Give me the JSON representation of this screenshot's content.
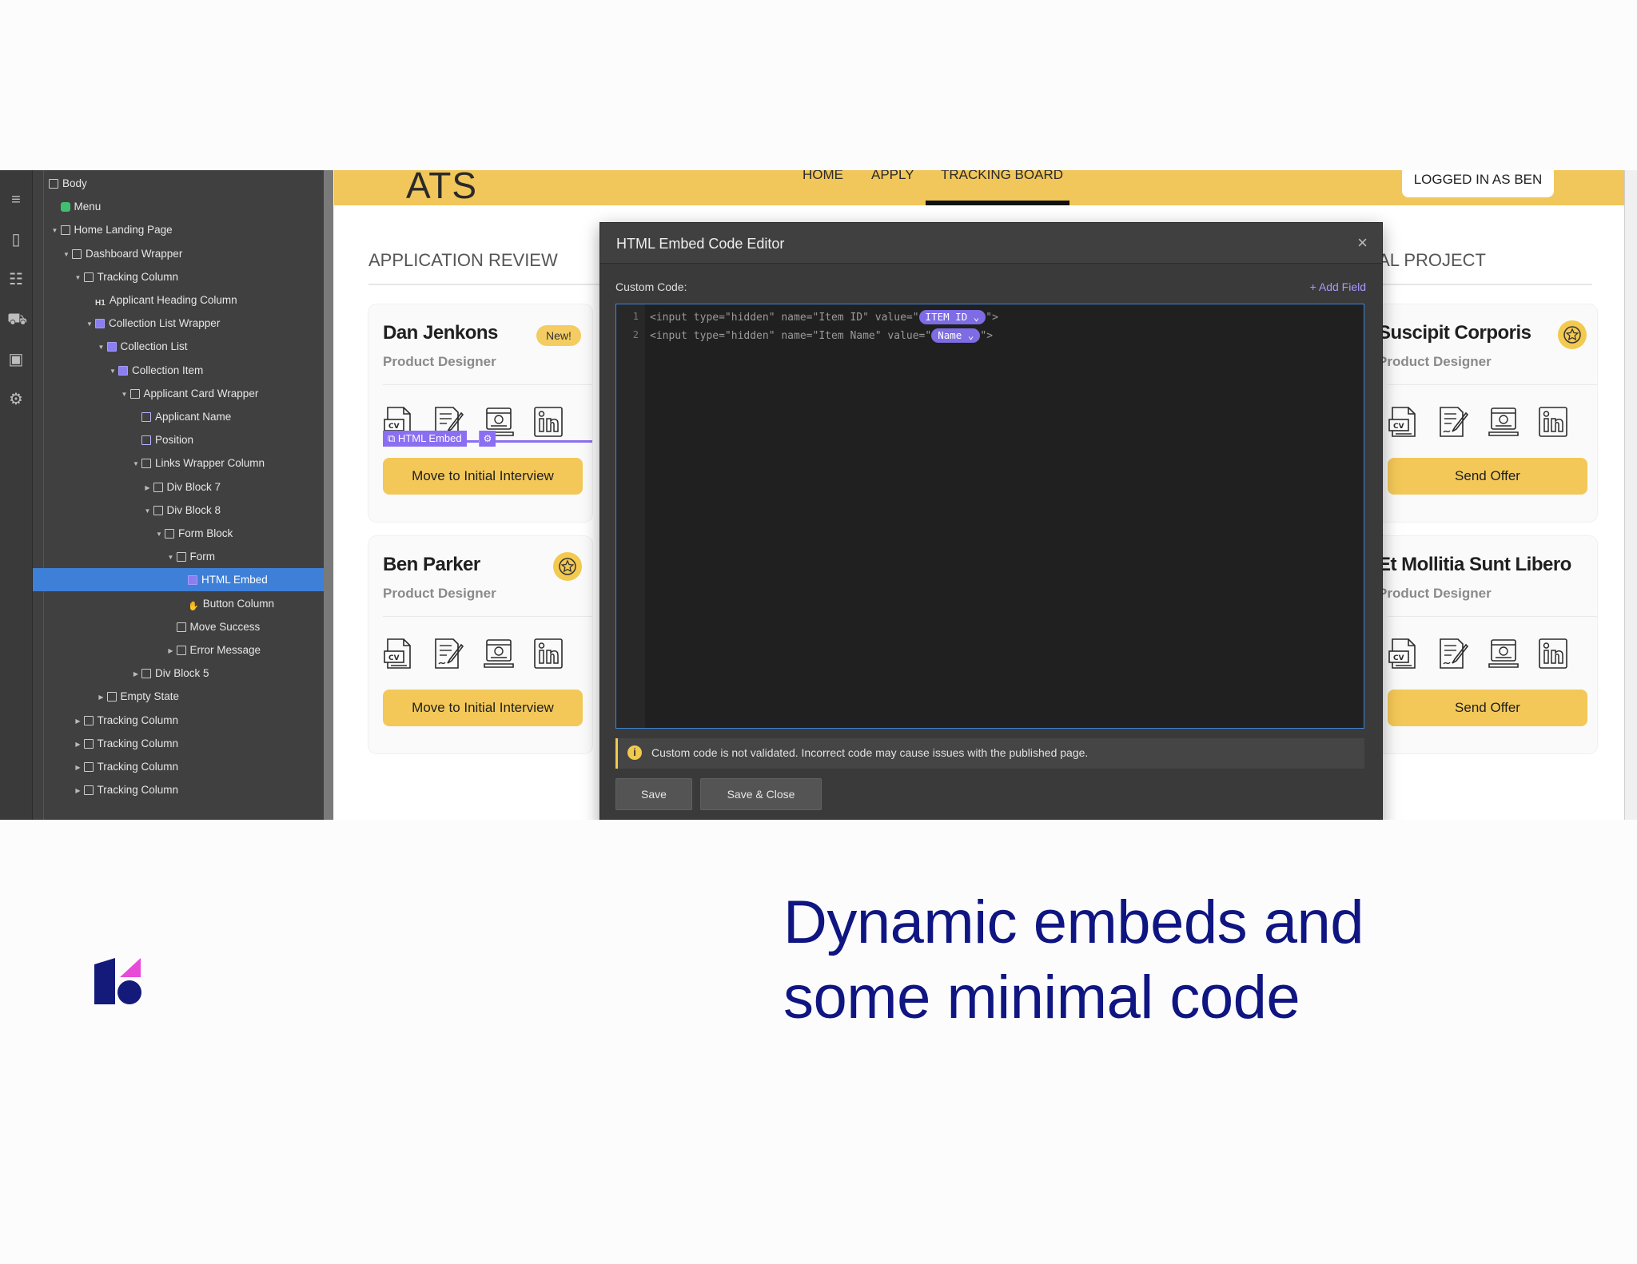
{
  "navigator": {
    "items": [
      {
        "label": "Body",
        "depth": 0,
        "icon": "box"
      },
      {
        "label": "Menu",
        "depth": 1,
        "icon": "component"
      },
      {
        "label": "Home Landing Page",
        "depth": 1,
        "icon": "box"
      },
      {
        "label": "Dashboard Wrapper",
        "depth": 2,
        "icon": "box"
      },
      {
        "label": "Tracking Column",
        "depth": 3,
        "icon": "box"
      },
      {
        "label": "Applicant Heading Column",
        "depth": 4,
        "icon": "h1"
      },
      {
        "label": "Collection List Wrapper",
        "depth": 4,
        "icon": "collection"
      },
      {
        "label": "Collection List",
        "depth": 5,
        "icon": "collection"
      },
      {
        "label": "Collection Item",
        "depth": 6,
        "icon": "collection"
      },
      {
        "label": "Applicant Card Wrapper",
        "depth": 7,
        "icon": "box"
      },
      {
        "label": "Applicant Name",
        "depth": 8,
        "icon": "text"
      },
      {
        "label": "Position",
        "depth": 8,
        "icon": "text"
      },
      {
        "label": "Links Wrapper Column",
        "depth": 8,
        "icon": "box"
      },
      {
        "label": "Div Block 7",
        "depth": 9,
        "icon": "box"
      },
      {
        "label": "Div Block 8",
        "depth": 9,
        "icon": "box"
      },
      {
        "label": "Form Block",
        "depth": 10,
        "icon": "form"
      },
      {
        "label": "Form",
        "depth": 11,
        "icon": "box"
      },
      {
        "label": "HTML Embed",
        "depth": 12,
        "icon": "embed",
        "selected": true
      },
      {
        "label": "Button Column",
        "depth": 12,
        "icon": "hand"
      },
      {
        "label": "Move Success",
        "depth": 11,
        "icon": "box"
      },
      {
        "label": "Error Message",
        "depth": 11,
        "icon": "box"
      },
      {
        "label": "Div Block 5",
        "depth": 8,
        "icon": "box"
      },
      {
        "label": "Empty State",
        "depth": 5,
        "icon": "form"
      },
      {
        "label": "Tracking Column",
        "depth": 3,
        "icon": "box"
      },
      {
        "label": "Tracking Column",
        "depth": 3,
        "icon": "box"
      },
      {
        "label": "Tracking Column",
        "depth": 3,
        "icon": "box"
      },
      {
        "label": "Tracking Column",
        "depth": 3,
        "icon": "box"
      }
    ]
  },
  "site": {
    "logo": "ATS",
    "menu": [
      "HOME",
      "APPLY",
      "TRACKING BOARD"
    ],
    "logged_in": "LOGGED IN AS BEN",
    "section_left": "APPLICATION REVIEW",
    "section_right": "IAL PROJECT"
  },
  "cards": [
    {
      "name": "Dan Jenkons",
      "role": "Product Designer",
      "badge": "New!",
      "button": "Move to Initial Interview"
    },
    {
      "name": "Ben Parker",
      "role": "Product Designer",
      "button": "Move to Initial Interview"
    },
    {
      "name": "Suscipit Corporis",
      "role": "Product Designer",
      "button": "Send Offer"
    },
    {
      "name": "Et Mollitia Sunt Libero",
      "role": "Product Designer",
      "button": "Send Offer"
    }
  ],
  "embed_label": "HTML Embed",
  "modal": {
    "title": "HTML Embed Code Editor",
    "close": "×",
    "custom_code_label": "Custom Code:",
    "add_field": "+ Add Field",
    "lines": [
      {
        "no": "1",
        "before": "<input type=\"hidden\" name=\"Item ID\" value=\"",
        "chip": "ITEM ID",
        "after": "\">"
      },
      {
        "no": "2",
        "before": "<input type=\"hidden\" name=\"Item Name\" value=\"",
        "chip": "Name",
        "after": "\">"
      }
    ],
    "warning": "Custom code is not validated. Incorrect code may cause issues with the published page.",
    "save": "Save",
    "save_close": "Save & Close"
  },
  "headline": [
    "Dynamic embeds and",
    "some minimal code"
  ],
  "colors": {
    "accent_yellow": "#f1c65a",
    "headline_blue": "#0f1581",
    "selection_blue": "#3e7fd8",
    "embed_purple": "#8b6ff2"
  }
}
